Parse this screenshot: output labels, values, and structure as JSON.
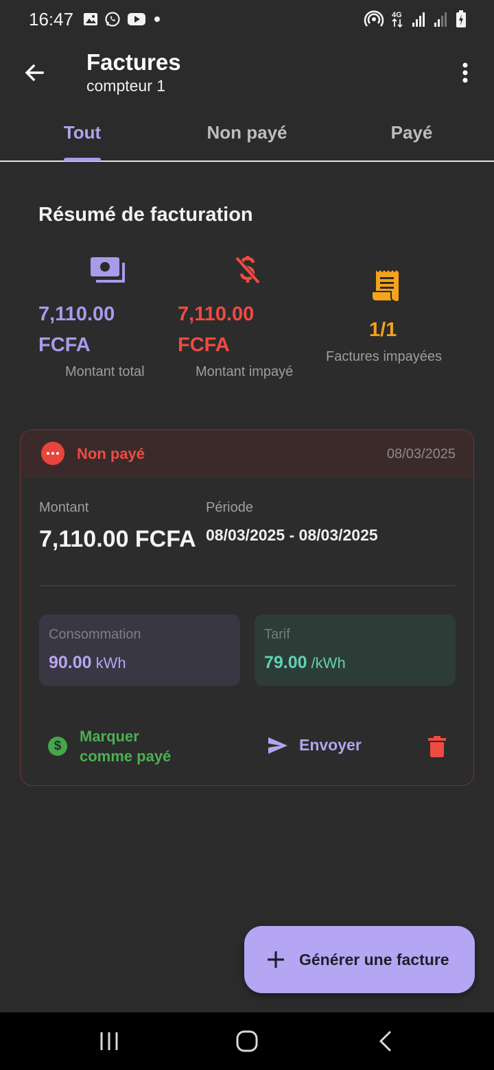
{
  "status_bar": {
    "time": "16:47",
    "network": "4G"
  },
  "app_bar": {
    "title": "Factures",
    "subtitle": "compteur 1"
  },
  "tabs": [
    {
      "label": "Tout",
      "active": true
    },
    {
      "label": "Non payé",
      "active": false
    },
    {
      "label": "Payé",
      "active": false
    }
  ],
  "summary": {
    "title": "Résumé de facturation",
    "total": {
      "amount": "7,110.00",
      "currency": "FCFA",
      "label": "Montant total",
      "icon": "payments-icon",
      "color": "#a99bea"
    },
    "unpaid": {
      "amount": "7,110.00",
      "currency": "FCFA",
      "label": "Montant impayé",
      "icon": "money-off-icon",
      "color": "#ef4b42"
    },
    "count": {
      "value": "1/1",
      "label": "Factures impayées",
      "icon": "receipt-icon",
      "color": "#f5a21c"
    }
  },
  "invoice": {
    "status": "Non payé",
    "date": "08/03/2025",
    "amount_label": "Montant",
    "amount_value": "7,110.00 FCFA",
    "period_label": "Période",
    "period_value": "08/03/2025 - 08/03/2025",
    "consumption_label": "Consommation",
    "consumption_value": "90.00",
    "consumption_unit": "kWh",
    "tarif_label": "Tarif",
    "tarif_value": "79.00",
    "tarif_unit": "/kWh",
    "mark_paid_label": "Marquer comme payé",
    "send_label": "Envoyer"
  },
  "fab": {
    "label": "Générer une facture"
  }
}
